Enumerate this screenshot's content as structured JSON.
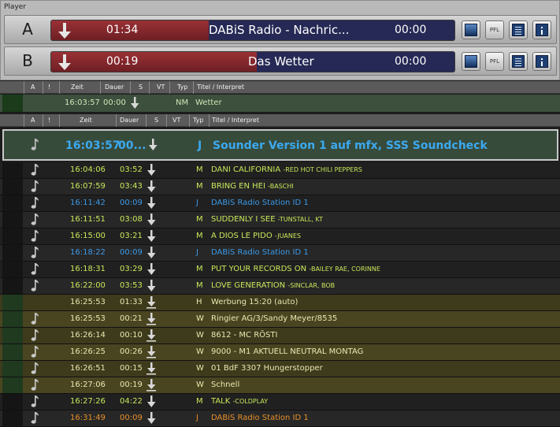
{
  "player": {
    "title": "Player",
    "decks": [
      {
        "letter": "A",
        "elapsed": "01:34",
        "title": "DABiS Radio - Nachric...",
        "remaining": "00:00",
        "progress": 0.39
      },
      {
        "letter": "B",
        "elapsed": "00:19",
        "title": "Das Wetter",
        "remaining": "00:00",
        "progress": 0.51
      }
    ],
    "pfl_label": "PFL"
  },
  "columns": {
    "a": "A",
    "excl": "!",
    "time": "Zeit",
    "duration": "Dauer",
    "s": "S",
    "vt": "VT",
    "type": "Typ",
    "title": "Titel / Interpret"
  },
  "next": {
    "time": "16:03:57",
    "duration": "00:00",
    "type": "NM",
    "title": "Wetter"
  },
  "current": {
    "time": "16:03:57",
    "duration": "00...",
    "type": "J",
    "title": "Sounder Version 1 auf mfx, SSS Soundcheck"
  },
  "colors": {
    "music": "#c8e85a",
    "jingle": "#3b9ae8",
    "ad": "#e8e8b0",
    "orange": "#e8902a"
  },
  "rows": [
    {
      "time": "16:04:06",
      "duration": "03:52",
      "type": "M",
      "title": "DANI CALIFORNIA",
      "artist": "-RED HOT CHILI PEPPERS",
      "kind": "music",
      "icon": "note",
      "mark": "dark"
    },
    {
      "time": "16:07:59",
      "duration": "03:43",
      "type": "M",
      "title": "BRING EN HEI",
      "artist": "-BASCHI",
      "kind": "music",
      "icon": "note",
      "mark": "dark"
    },
    {
      "time": "16:11:42",
      "duration": "00:09",
      "type": "J",
      "title": "DABiS Radio Station ID 1",
      "artist": "",
      "kind": "jingle",
      "icon": "note",
      "mark": "dark"
    },
    {
      "time": "16:11:51",
      "duration": "03:08",
      "type": "M",
      "title": "SUDDENLY I SEE",
      "artist": "-TUNSTALL, KT",
      "kind": "music",
      "icon": "note",
      "mark": "dark"
    },
    {
      "time": "16:15:00",
      "duration": "03:21",
      "type": "M",
      "title": "A DIOS LE PIDO",
      "artist": "-JUANES",
      "kind": "music",
      "icon": "note",
      "mark": "dark"
    },
    {
      "time": "16:18:22",
      "duration": "00:09",
      "type": "J",
      "title": "DABiS Radio Station ID 1",
      "artist": "",
      "kind": "jingle",
      "icon": "note",
      "mark": "dark"
    },
    {
      "time": "16:18:31",
      "duration": "03:29",
      "type": "M",
      "title": "PUT YOUR RECORDS ON",
      "artist": "-BAILEY RAE, CORINNE",
      "kind": "music",
      "icon": "note",
      "mark": "dark"
    },
    {
      "time": "16:22:00",
      "duration": "03:53",
      "type": "M",
      "title": "LOVE GENERATION",
      "artist": "-SINCLAR, BOB",
      "kind": "music",
      "icon": "note",
      "mark": "dark"
    },
    {
      "time": "16:25:53",
      "duration": "01:33",
      "type": "H",
      "title": "Werbung 15:20 (auto)",
      "artist": "",
      "kind": "header",
      "icon": "",
      "mark": "green"
    },
    {
      "time": "16:25:53",
      "duration": "00:21",
      "type": "W",
      "title": "Ringier AG/3/Sandy Meyer/8535",
      "artist": "",
      "kind": "ad",
      "icon": "note",
      "mark": "green"
    },
    {
      "time": "16:26:14",
      "duration": "00:10",
      "type": "W",
      "title": "8612 - MC RÖSTI",
      "artist": "",
      "kind": "ad",
      "icon": "note",
      "mark": "green"
    },
    {
      "time": "16:26:25",
      "duration": "00:26",
      "type": "W",
      "title": "9000 - M1 AKTUELL NEUTRAL MONTAG",
      "artist": "",
      "kind": "ad",
      "icon": "note",
      "mark": "green"
    },
    {
      "time": "16:26:51",
      "duration": "00:15",
      "type": "W",
      "title": "01 BdF 3307 Hungerstopper",
      "artist": "",
      "kind": "ad",
      "icon": "note",
      "mark": "green"
    },
    {
      "time": "16:27:06",
      "duration": "00:19",
      "type": "W",
      "title": "Schnell",
      "artist": "",
      "kind": "ad",
      "icon": "note",
      "mark": "green"
    },
    {
      "time": "16:27:26",
      "duration": "04:22",
      "type": "M",
      "title": "TALK",
      "artist": "-COLDPLAY",
      "kind": "music",
      "icon": "note",
      "mark": "dark"
    },
    {
      "time": "16:31:49",
      "duration": "00:09",
      "type": "J",
      "title": "DABiS Radio Station ID 1",
      "artist": "",
      "kind": "jingle-orange",
      "icon": "note",
      "mark": "dark"
    }
  ]
}
